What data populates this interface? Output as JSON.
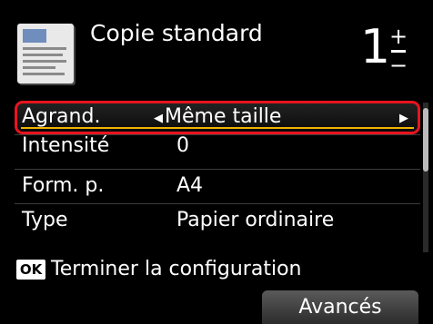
{
  "header": {
    "title": "Copie standard",
    "copies": "1",
    "plus_symbol": "+",
    "minus_symbol": "−"
  },
  "settings": [
    {
      "label": "Agrand.",
      "value": "Même taille"
    },
    {
      "label": "Intensité",
      "value": "0"
    },
    {
      "label": "Form. p.",
      "value": "A4"
    },
    {
      "label": "Type",
      "value": "Papier ordinaire"
    }
  ],
  "hint": {
    "key": "OK",
    "text": "Terminer la configuration"
  },
  "buttons": {
    "advanced": "Avancés"
  },
  "icons": {
    "document": "document-icon",
    "left": "arrow-left-icon",
    "right": "arrow-right-icon"
  },
  "colors": {
    "highlight_border": "#e8141f",
    "highlight_underline": "#f0b400",
    "background": "#000000"
  }
}
